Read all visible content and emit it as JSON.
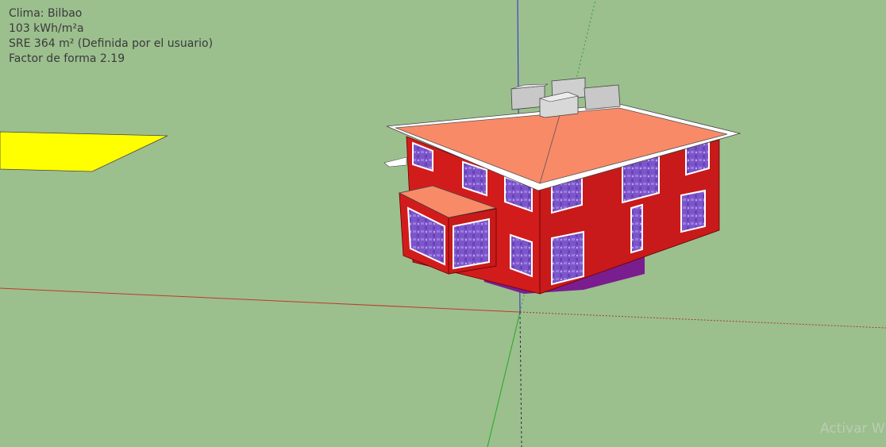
{
  "info_panel": {
    "climate": "Clima: Bilbao",
    "energy": "103 kWh/m²a",
    "sre": "SRE  364 m² (Definida por el usuario)",
    "form_factor": "Factor de forma 2.19"
  },
  "watermark": "Activar W",
  "colors": {
    "background": "#9cbf8e",
    "axis_red": "#c0392b",
    "axis_green": "#22aa22",
    "axis_blue": "#2a2ad0",
    "roof": "#f88a68",
    "wall": "#d21c1c",
    "glass": "#7a52c8",
    "yellow_plane": "#ffff00"
  },
  "icons": {
    "model": "3d-building-model"
  }
}
